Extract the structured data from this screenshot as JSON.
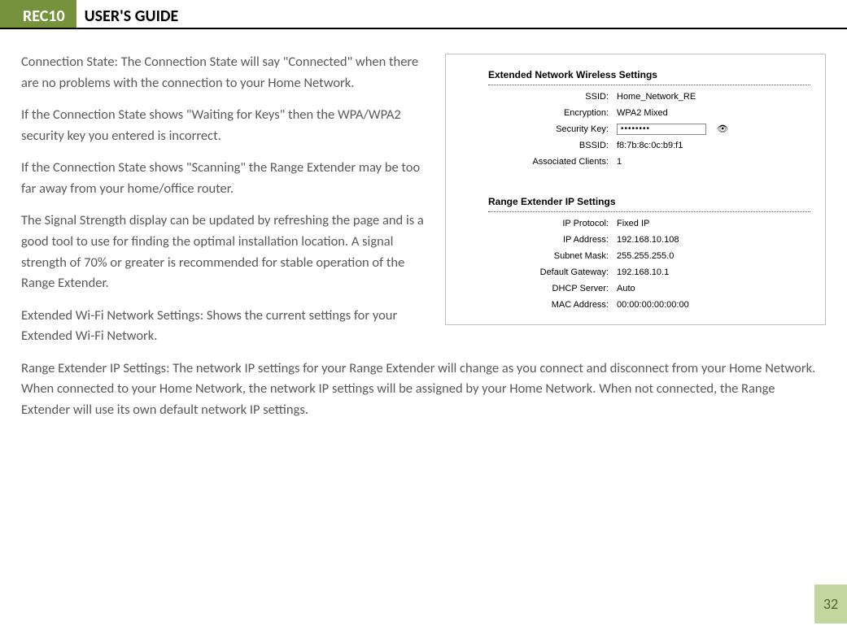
{
  "header": {
    "badge": "REC10",
    "title": "USER'S GUIDE"
  },
  "body": {
    "p1": "Connection State: The Connection State will say \"Connected\" when there are no problems with the connection to your Home Network.",
    "p2": "If the Connection State shows \"Waiting for Keys\" then the WPA/WPA2 security key you entered is incorrect.",
    "p3": "If the Connection State shows \"Scanning\" the Range Extender may be too far away from your home/office router.",
    "p4": "The Signal Strength display can be updated by refreshing the page and is a good tool to use for finding the optimal installation location. A signal strength of 70% or greater is recommended for stable operation of the Range Extender.",
    "p5": "Extended Wi-Fi Network Settings: Shows the current settings for your Extended Wi-Fi Network.",
    "p6": "Range Extender IP Settings:  The network IP settings for your Range Extender will change as you connect and disconnect from your Home Network. When connected to your Home Network, the network IP settings will be assigned by your Home Network. When not connected, the Range Extender will use its own default network IP settings."
  },
  "figure": {
    "section1_title": "Extended Network Wireless Settings",
    "ssid_label": "SSID:",
    "ssid_value": "Home_Network_RE",
    "enc_label": "Encryption:",
    "enc_value": "WPA2 Mixed",
    "key_label": "Security Key:",
    "key_value": "••••••••",
    "bssid_label": "BSSID:",
    "bssid_value": "f8:7b:8c:0c:b9:f1",
    "clients_label": "Associated Clients:",
    "clients_value": "1",
    "section2_title": "Range Extender IP Settings",
    "proto_label": "IP Protocol:",
    "proto_value": "Fixed IP",
    "ip_label": "IP Address:",
    "ip_value": "192.168.10.108",
    "mask_label": "Subnet Mask:",
    "mask_value": "255.255.255.0",
    "gw_label": "Default Gateway:",
    "gw_value": "192.168.10.1",
    "dhcp_label": "DHCP Server:",
    "dhcp_value": "Auto",
    "mac_label": "MAC Address:",
    "mac_value": "00:00:00:00:00:00"
  },
  "page_number": "32"
}
